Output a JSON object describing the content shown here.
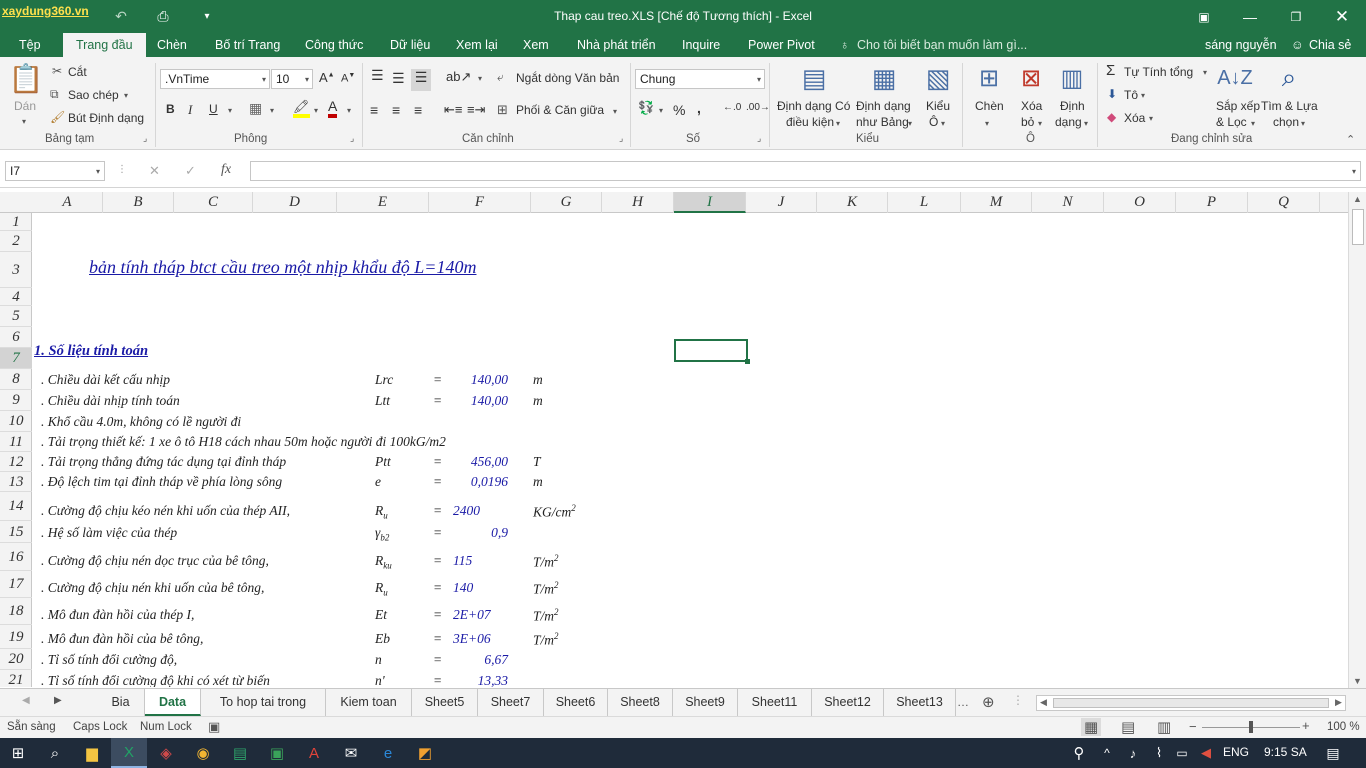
{
  "window": {
    "title": "Thap cau treo.XLS  [Chế độ Tương thích] - Excel",
    "watermark": "xaydung360.vn"
  },
  "ribbon_tabs": [
    "Tệp",
    "Trang đầu",
    "Chèn",
    "Bố trí Trang",
    "Công thức",
    "Dữ liệu",
    "Xem lại",
    "Xem",
    "Nhà phát triển",
    "Inquire",
    "Power Pivot"
  ],
  "tell_me": "Cho tôi biết bạn muốn làm gì...",
  "user": "sáng nguyễn",
  "share": "Chia sẻ",
  "ribbon": {
    "paste": "Dán",
    "cut": "Cắt",
    "copy": "Sao chép",
    "format_painter": "Bút Định dạng",
    "clipboard": "Bảng tạm",
    "font_name": ".VnTime",
    "font_size": "10",
    "font": "Phông",
    "bold": "B",
    "italic": "I",
    "underline": "U",
    "wrap": "Ngắt dòng Văn bản",
    "merge": "Phối & Căn giữa",
    "alignment": "Căn chỉnh",
    "number_format": "Chung",
    "number": "Số",
    "cond_format": "Định dạng Có điều kiện",
    "cond_format_1": "Định dạng Có",
    "cond_format_2": "điều kiện",
    "format_table_1": "Định dạng",
    "format_table_2": "như Bảng",
    "cell_styles_1": "Kiểu",
    "cell_styles_2": "Ô",
    "styles": "Kiểu",
    "insert": "Chèn",
    "delete_1": "Xóa",
    "delete_2": "bỏ",
    "format_1": "Định",
    "format_2": "dạng",
    "cells": "Ô",
    "autosum": "Tự Tính tổng",
    "fill": "Tô",
    "clear": "Xóa",
    "sort_1": "Sắp xếp",
    "sort_2": "& Lọc",
    "find_1": "Tìm & Lựa",
    "find_2": "chọn",
    "editing": "Đang chỉnh sửa"
  },
  "formula_bar": {
    "name_box": "I7",
    "fx": "fx",
    "formula": ""
  },
  "columns": [
    "A",
    "B",
    "C",
    "D",
    "E",
    "F",
    "G",
    "H",
    "I",
    "J",
    "K",
    "L",
    "M",
    "N",
    "O",
    "P",
    "Q"
  ],
  "rows": [
    "1",
    "2",
    "3",
    "4",
    "5",
    "6",
    "7",
    "8",
    "9",
    "10",
    "11",
    "12",
    "13",
    "14",
    "15",
    "16",
    "17",
    "18",
    "19",
    "20",
    "21"
  ],
  "sheet": {
    "title": "bản tính tháp btct cầu treo một nhịp khẩu độ L=140m",
    "section": "1. Số liệu tính toán",
    "lines": [
      {
        "label": ". Chiều dài kết cấu nhịp",
        "sym": "Lrc",
        "eq": "=",
        "val": "140,00",
        "unit": "m"
      },
      {
        "label": ". Chiều dài nhịp tính toán",
        "sym": "Ltt",
        "eq": "=",
        "val": "140,00",
        "unit": "m"
      },
      {
        "label": ". Khổ cầu 4.0m, không có lề người đi",
        "sym": "",
        "eq": "",
        "val": "",
        "unit": ""
      },
      {
        "label": ". Tải trọng thiết kế: 1 xe ô tô H18 cách nhau 50m hoặc người đi  100kG/m2",
        "sym": "",
        "eq": "",
        "val": "",
        "unit": ""
      },
      {
        "label": ". Tải trọng thẳng đứng tác dụng tại đỉnh tháp",
        "sym": "Ptt",
        "eq": "=",
        "val": "456,00",
        "unit": "T"
      },
      {
        "label": ". Độ lệch tim tại đỉnh tháp về phía lòng sông",
        "sym": "e",
        "eq": "=",
        "val": "0,0196",
        "unit": "m"
      },
      {
        "label": ". Cường độ chịu kéo nén khi uốn của thép AII,",
        "sym": "Ru",
        "eq": "=",
        "val": "2400",
        "unit": "KG/cm2"
      },
      {
        "label": ". Hệ số làm việc của thép",
        "sym": "γb2",
        "eq": "=",
        "val": "0,9",
        "unit": ""
      },
      {
        "label": ". Cường độ chịu nén dọc trục của bê tông,",
        "sym": "Rku",
        "eq": "=",
        "val": "115",
        "unit": "T/m2"
      },
      {
        "label": ". Cường độ chịu nén khi uốn của bê tông,",
        "sym": "Ru",
        "eq": "=",
        "val": "140",
        "unit": "T/m2"
      },
      {
        "label": ". Mô đun đàn hồi của thép I,",
        "sym": "Et",
        "eq": "=",
        "val": "2E+07",
        "unit": "T/m2"
      },
      {
        "label": ". Mô đun đàn hồi của bê tông,",
        "sym": "Eb",
        "eq": "=",
        "val": "3E+06",
        "unit": "T/m2"
      },
      {
        "label": ". Tỉ số tính đổi cường độ,",
        "sym": "n",
        "eq": "=",
        "val": "6,67",
        "unit": ""
      },
      {
        "label": ". Tỉ số tính đổi cường độ khi có xét từ biến",
        "sym": "n'",
        "eq": "=",
        "val": "13,33",
        "unit": ""
      }
    ]
  },
  "sheet_tabs": [
    "Bia",
    "Data",
    "To hop tai trong",
    "Kiem toan",
    "Sheet5",
    "Sheet7",
    "Sheet6",
    "Sheet8",
    "Sheet9",
    "Sheet11",
    "Sheet12",
    "Sheet13"
  ],
  "active_sheet": "Data",
  "status": {
    "ready": "Sẵn sàng",
    "caps": "Caps Lock",
    "num": "Num Lock",
    "zoom": "100 %",
    "zoom_level": 1.0
  },
  "taskbar": {
    "lang": "ENG",
    "time": "9:15 SA"
  }
}
